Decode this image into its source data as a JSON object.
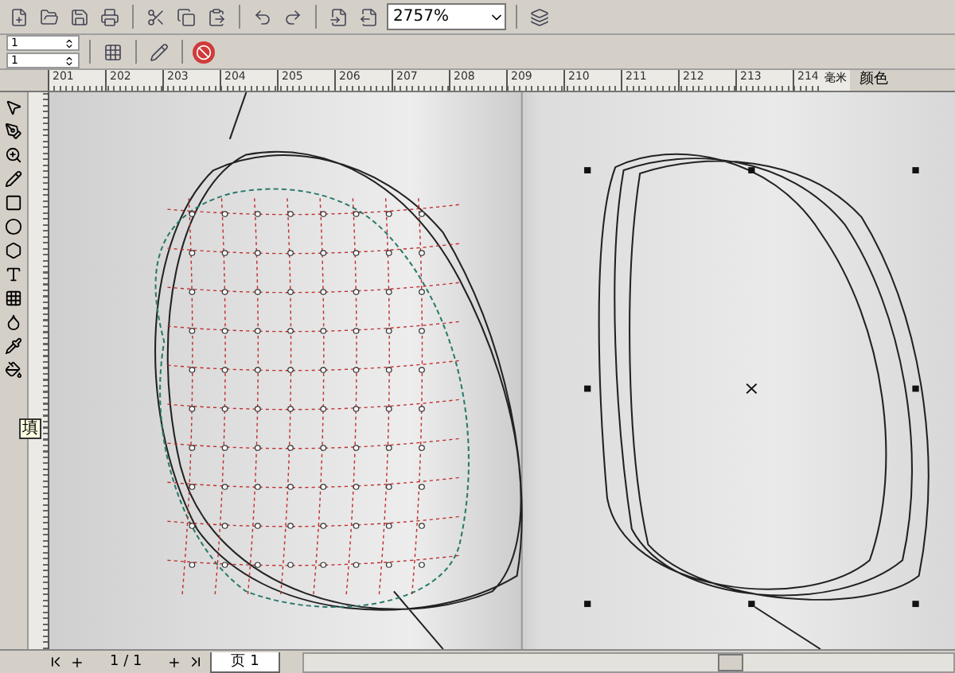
{
  "toolbar": {
    "zoom": "2757%"
  },
  "property_bar": {
    "fields": [
      {
        "value": "1"
      },
      {
        "value": "1"
      }
    ]
  },
  "ruler": {
    "ticks": [
      "201",
      "202",
      "203",
      "204",
      "205",
      "206",
      "207",
      "208",
      "209",
      "210",
      "211",
      "212",
      "213",
      "214"
    ],
    "units": "毫米"
  },
  "docker": {
    "title": "颜色"
  },
  "toolbox": {
    "tooltip": "填"
  },
  "page_nav": {
    "counter": "1 / 1",
    "tabs": [
      {
        "label": "页 1",
        "selected": true
      }
    ]
  }
}
